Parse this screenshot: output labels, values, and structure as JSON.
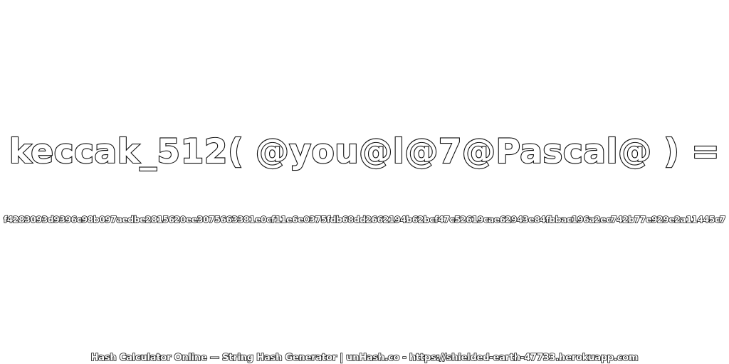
{
  "expression": "keccak_512( @you@l@7@Pascal@ ) =",
  "hash": "f4283093d9396c98b097aedbe2815620ee3075663381e0cf11e6e0375fdb68dd2662194b62bcf47c52619cae62943e84fbbac196a2ec742b77e929e2a11445c7",
  "footer": "Hash Calculator Online — String Hash Generator | unHash.co - https://shielded-earth-47733.herokuapp.com"
}
